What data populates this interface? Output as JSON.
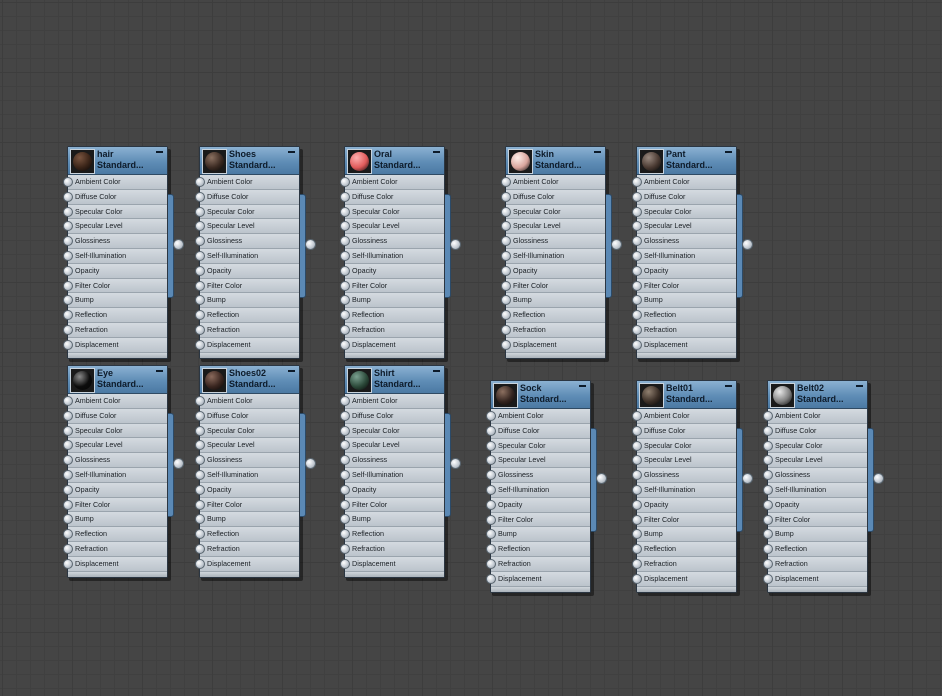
{
  "colors": {
    "background": "#454545",
    "header": "#5f8db6",
    "body": "#c5ccd3",
    "output_bar": "#5b89b5"
  },
  "slot_labels": [
    "Ambient Color",
    "Diffuse Color",
    "Specular Color",
    "Specular Level",
    "Glossiness",
    "Self-Illumination",
    "Opacity",
    "Filter Color",
    "Bump",
    "Reflection",
    "Refraction",
    "Displacement"
  ],
  "nodes": [
    {
      "name": "hair",
      "type": "Standard...",
      "swatch": "#3a2418",
      "highlight": "#7a5540"
    },
    {
      "name": "Shoes",
      "type": "Standard...",
      "swatch": "#3b2a22",
      "highlight": "#8a7060"
    },
    {
      "name": "Oral",
      "type": "Standard...",
      "swatch": "#e05a5a",
      "highlight": "#ffb0b0"
    },
    {
      "name": "Skin",
      "type": "Standard...",
      "swatch": "#d9a49c",
      "highlight": "#fff0ea"
    },
    {
      "name": "Pant",
      "type": "Standard...",
      "swatch": "#4a3a32",
      "highlight": "#9a8a80"
    },
    {
      "name": "Eye",
      "type": "Standard...",
      "swatch": "#0c0c0c",
      "highlight": "#8a8a8a"
    },
    {
      "name": "Shoes02",
      "type": "Standard...",
      "swatch": "#3a2620",
      "highlight": "#8a6a5c"
    },
    {
      "name": "Shirt",
      "type": "Standard...",
      "swatch": "#2c4a3a",
      "highlight": "#7aa090"
    },
    {
      "name": "Sock",
      "type": "Standard...",
      "swatch": "#342520",
      "highlight": "#8c7060"
    },
    {
      "name": "Belt01",
      "type": "Standard...",
      "swatch": "#3c3028",
      "highlight": "#908070"
    },
    {
      "name": "Belt02",
      "type": "Standard...",
      "swatch": "#808080",
      "highlight": "#e8e8e8"
    }
  ]
}
